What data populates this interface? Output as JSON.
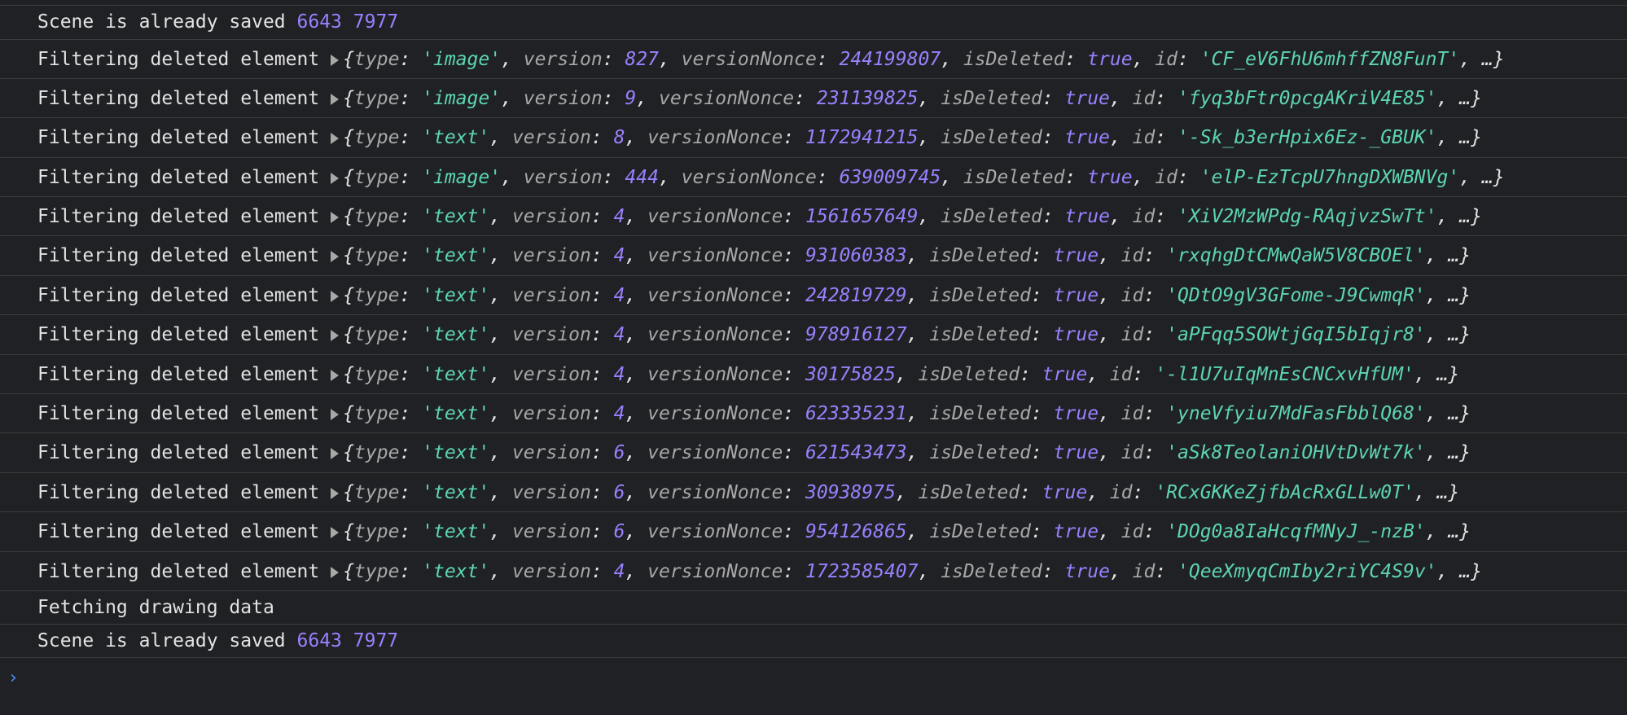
{
  "console": {
    "saved_top": {
      "text": "Scene is already saved",
      "n1": "6643",
      "n2": "7977"
    },
    "filter_label": "Filtering deleted element",
    "entries": [
      {
        "type": "'image'",
        "version": "827",
        "nonce": "244199807",
        "id": "'CF_eV6FhU6mhffZN8FunT'"
      },
      {
        "type": "'image'",
        "version": "9",
        "nonce": "231139825",
        "id": "'fyq3bFtr0pcgAKriV4E85'"
      },
      {
        "type": "'text'",
        "version": "8",
        "nonce": "1172941215",
        "id": "'-Sk_b3erHpix6Ez-_GBUK'"
      },
      {
        "type": "'image'",
        "version": "444",
        "nonce": "639009745",
        "id": "'elP-EzTcpU7hngDXWBNVg'"
      },
      {
        "type": "'text'",
        "version": "4",
        "nonce": "1561657649",
        "id": "'XiV2MzWPdg-RAqjvzSwTt'"
      },
      {
        "type": "'text'",
        "version": "4",
        "nonce": "931060383",
        "id": "'rxqhgDtCMwQaW5V8CBOEl'"
      },
      {
        "type": "'text'",
        "version": "4",
        "nonce": "242819729",
        "id": "'QDtO9gV3GFome-J9CwmqR'"
      },
      {
        "type": "'text'",
        "version": "4",
        "nonce": "978916127",
        "id": "'aPFqq5SOWtjGqI5bIqjr8'"
      },
      {
        "type": "'text'",
        "version": "4",
        "nonce": "30175825",
        "id": "'-l1U7uIqMnEsCNCxvHfUM'"
      },
      {
        "type": "'text'",
        "version": "4",
        "nonce": "623335231",
        "id": "'yneVfyiu7MdFasFbblQ68'"
      },
      {
        "type": "'text'",
        "version": "6",
        "nonce": "621543473",
        "id": "'aSk8TeolaniOHVtDvWt7k'"
      },
      {
        "type": "'text'",
        "version": "6",
        "nonce": "30938975",
        "id": "'RCxGKKeZjfbAcRxGLLw0T'"
      },
      {
        "type": "'text'",
        "version": "6",
        "nonce": "954126865",
        "id": "'DOg0a8IaHcqfMNyJ_-nzB'"
      },
      {
        "type": "'text'",
        "version": "4",
        "nonce": "1723585407",
        "id": "'QeeXmyqCmIby2riYC4S9v'"
      }
    ],
    "fetching": "Fetching drawing data",
    "saved_bottom": {
      "text": "Scene is already saved",
      "n1": "6643",
      "n2": "7977"
    },
    "prompt_symbol": "›",
    "keys": {
      "type": "type",
      "version": "version",
      "nonce": "versionNonce",
      "deleted": "isDeleted",
      "id": "id",
      "bool_true": "true",
      "ellipsis": "…"
    }
  },
  "colors": {
    "background": "#202124",
    "string": "#5cd5b1",
    "number": "#9980ff",
    "key": "#a8a8a8",
    "prompt": "#4c8df6"
  }
}
